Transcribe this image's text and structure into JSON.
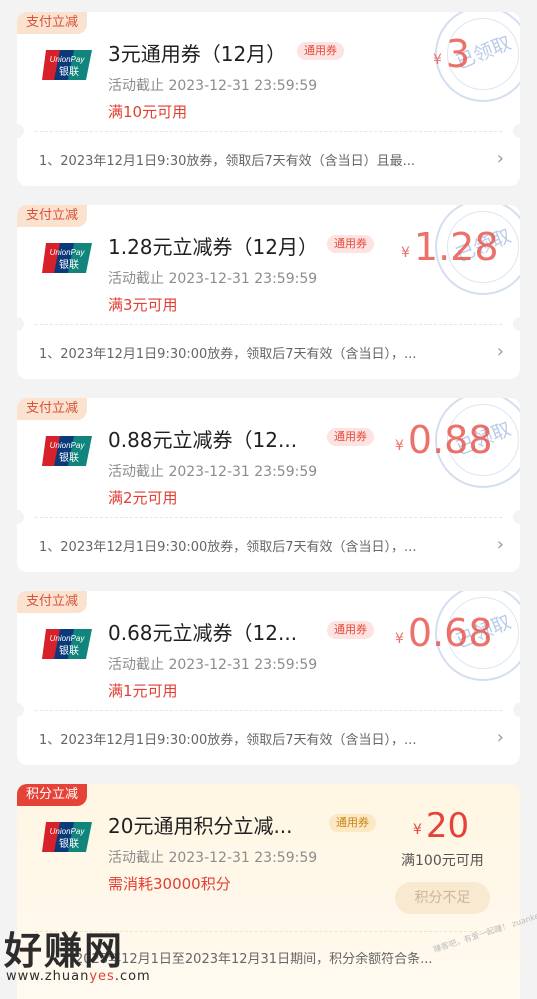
{
  "colors": {
    "accent": "#e64338",
    "tag_bg": "#fbe2cf",
    "stamp": "#a8bfe3",
    "gold": "#c88417"
  },
  "coupons": [
    {
      "tag": "支付立减",
      "title": "3元通用券（12月）",
      "badge": "通用券",
      "deadline": "活动截止 2023-12-31 23:59:59",
      "condition": "满10元可用",
      "currency": "¥",
      "amount": "3",
      "stamp": "已领取",
      "note": "1、2023年12月1日9:30放券，领取后7天有效（含当日）且最..."
    },
    {
      "tag": "支付立减",
      "title": "1.28元立减券（12月）",
      "badge": "通用券",
      "deadline": "活动截止 2023-12-31 23:59:59",
      "condition": "满3元可用",
      "currency": "¥",
      "amount": "1.28",
      "stamp": "已领取",
      "note": "1、2023年12月1日9:30:00放券，领取后7天有效（含当日），..."
    },
    {
      "tag": "支付立减",
      "title": "0.88元立减券（12...",
      "badge": "通用券",
      "deadline": "活动截止 2023-12-31 23:59:59",
      "condition": "满2元可用",
      "currency": "¥",
      "amount": "0.88",
      "stamp": "已领取",
      "note": "1、2023年12月1日9:30:00放券，领取后7天有效（含当日），..."
    },
    {
      "tag": "支付立减",
      "title": "0.68元立减券（12...",
      "badge": "通用券",
      "deadline": "活动截止 2023-12-31 23:59:59",
      "condition": "满1元可用",
      "currency": "¥",
      "amount": "0.68",
      "stamp": "已领取",
      "note": "1、2023年12月1日9:30:00放券，领取后7天有效（含当日），..."
    }
  ],
  "points_coupon": {
    "tag": "积分立减",
    "title": "20元通用积分立减...",
    "badge": "通用券",
    "deadline": "活动截止 2023-12-31 23:59:59",
    "condition": "需消耗30000积分",
    "currency": "¥",
    "amount": "20",
    "min_pay": "满100元可用",
    "button": "积分不足",
    "note": "2023年12月1日至2023年12月31日期间，积分余额符合条..."
  },
  "watermark": {
    "big": "好赚网",
    "url_prefix": "www.zhuan",
    "url_mid": "yes",
    "url_suffix": ".com",
    "stamp": "赚客吧，有爱一起赚！ zuanke8"
  },
  "icons": {
    "chevron": "chevron-right-icon",
    "logo": "unionpay-logo"
  }
}
